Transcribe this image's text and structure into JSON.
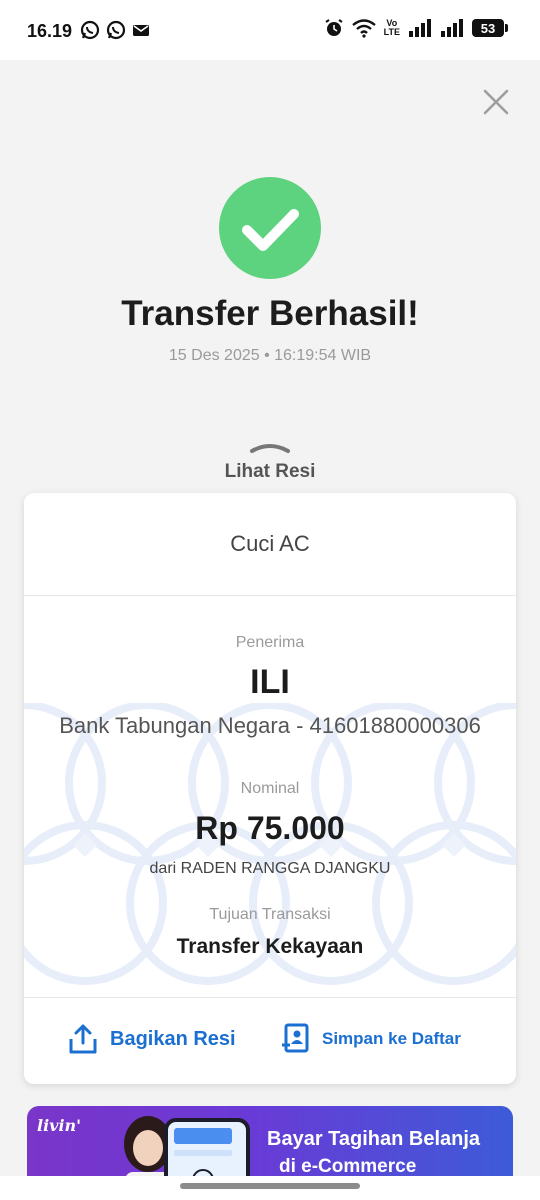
{
  "status_bar": {
    "time": "16.19",
    "left_icons": [
      "whatsapp-icon",
      "whatsapp-icon",
      "gmail-icon"
    ],
    "right_icons": [
      "alarm-icon",
      "wifi-icon",
      "volte-icon",
      "signal-icon",
      "signal-icon"
    ],
    "volte_top": "Vo",
    "volte_bottom": "LTE",
    "battery": "53"
  },
  "success": {
    "title": "Transfer Berhasil!",
    "datetime": "15 Des 2025 • 16:19:54 WIB"
  },
  "receipt_toggle": {
    "label": "Lihat Resi"
  },
  "receipt": {
    "note": "Cuci AC",
    "recipient_label": "Penerima",
    "recipient_name": "ILI",
    "recipient_bank": "Bank Tabungan Negara - 41601880000306",
    "amount_label": "Nominal",
    "amount": "Rp 75.000",
    "from": "dari RADEN RANGGA DJANGKU",
    "purpose_label": "Tujuan Transaksi",
    "purpose": "Transfer Kekayaan"
  },
  "actions": {
    "share_label": "Bagikan Resi",
    "save_label": "Simpan ke Daftar"
  },
  "banner": {
    "logo": "livin'",
    "line1": "Bayar Tagihan Belanja",
    "line2": "di e-Commerce"
  },
  "colors": {
    "success_green": "#5dd27f",
    "action_blue": "#1a6fd1",
    "banner_purple": "#7a35c9"
  }
}
